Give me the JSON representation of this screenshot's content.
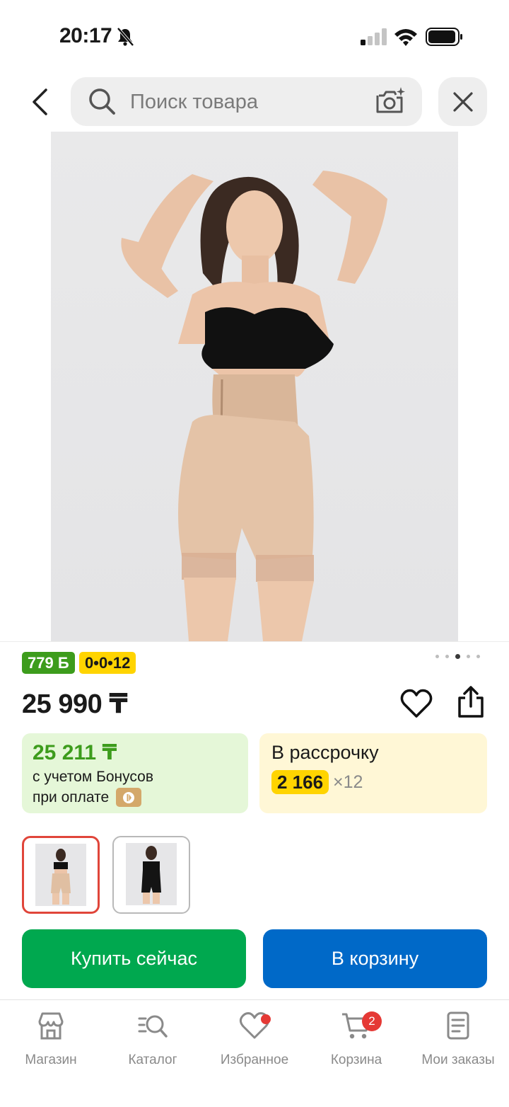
{
  "status_bar": {
    "time": "20:17"
  },
  "search": {
    "placeholder": "Поиск товара"
  },
  "product": {
    "bonus_badge": "779 Б",
    "installment_badge": "0•0•12",
    "price": "25 990 ₸",
    "image_count": 5,
    "active_image_index": 2
  },
  "bonus_card": {
    "price": "25 211 ₸",
    "line1": "с учетом Бонусов",
    "line2": "при оплате"
  },
  "installment_card": {
    "title": "В рассрочку",
    "amount": "2 166",
    "months": "×12"
  },
  "actions": {
    "buy_now": "Купить сейчас",
    "add_to_cart": "В корзину"
  },
  "bottom_nav": {
    "items": [
      {
        "label": "Магазин",
        "icon": "store-icon"
      },
      {
        "label": "Каталог",
        "icon": "catalog-search-icon"
      },
      {
        "label": "Избранное",
        "icon": "heart-icon"
      },
      {
        "label": "Корзина",
        "icon": "cart-icon",
        "badge": "2"
      },
      {
        "label": "Мои заказы",
        "icon": "orders-icon"
      }
    ]
  },
  "colors": {
    "bonus_green": "#3d9c1c",
    "installment_yellow": "#ffd400",
    "buy_green": "#00a84f",
    "cart_blue": "#0069c8",
    "badge_red": "#e53935"
  }
}
